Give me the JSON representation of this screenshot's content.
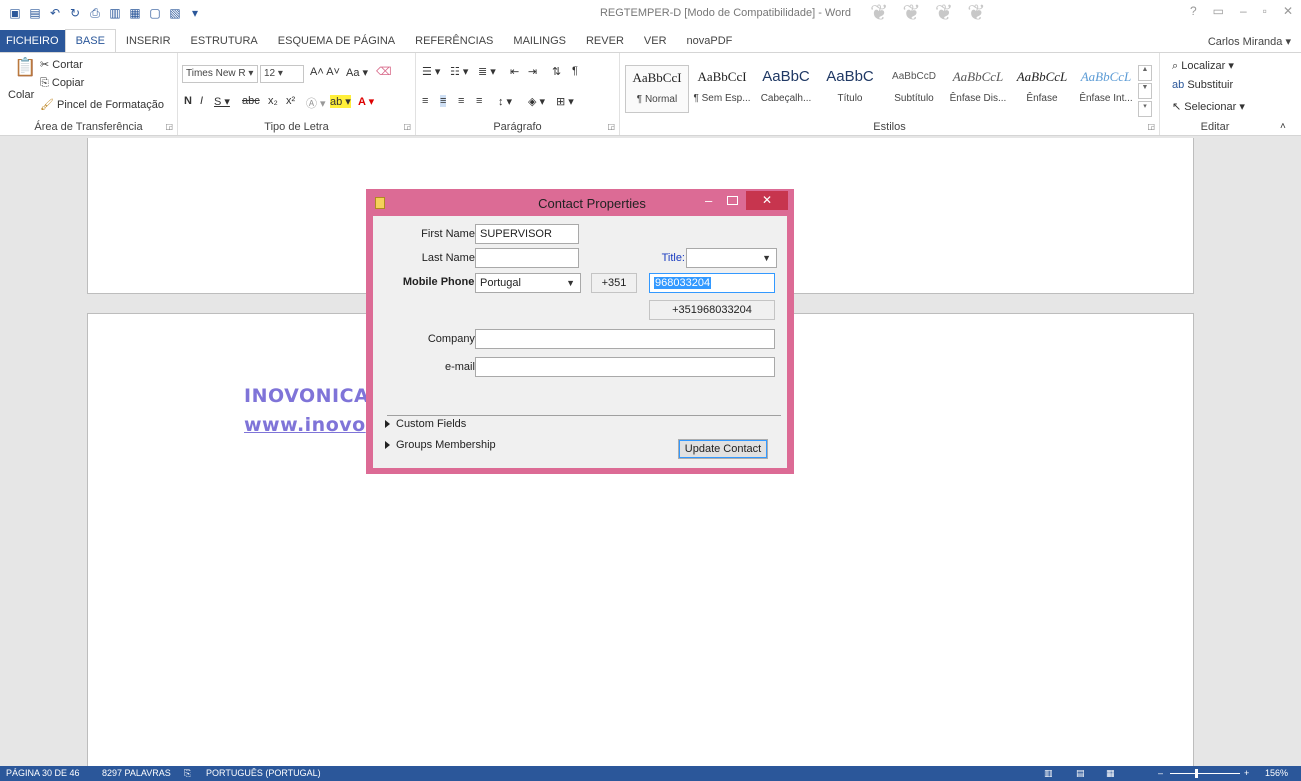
{
  "window": {
    "title": "REGTEMPER-D [Modo de Compatibilidade] - Word",
    "user": "Carlos Miranda"
  },
  "tabs": [
    "FICHEIRO",
    "BASE",
    "INSERIR",
    "ESTRUTURA",
    "ESQUEMA DE PÁGINA",
    "REFERÊNCIAS",
    "MAILINGS",
    "REVER",
    "VER",
    "novaPDF"
  ],
  "ribbon": {
    "clipboard": {
      "paste": "Colar",
      "cut": "Cortar",
      "copy": "Copiar",
      "format_painter": "Pincel de Formatação",
      "label": "Área de Transferência"
    },
    "font": {
      "name": "Times New R",
      "size": "12",
      "label": "Tipo de Letra"
    },
    "paragraph": {
      "label": "Parágrafo"
    },
    "styles": {
      "label": "Estilos",
      "items": [
        {
          "sample": "AaBbCcI",
          "name": "¶ Normal"
        },
        {
          "sample": "AaBbCcI",
          "name": "¶ Sem Esp..."
        },
        {
          "sample": "AaBbC",
          "name": "Cabeçalh..."
        },
        {
          "sample": "AaBbC",
          "name": "Título"
        },
        {
          "sample": "AaBbCcD",
          "name": "Subtítulo"
        },
        {
          "sample": "AaBbCcL",
          "name": "Ênfase Dis..."
        },
        {
          "sample": "AaBbCcL",
          "name": "Ênfase"
        },
        {
          "sample": "AaBbCcL",
          "name": "Ênfase Int..."
        }
      ]
    },
    "edit": {
      "find": "Localizar",
      "replace": "Substituir",
      "select": "Selecionar",
      "label": "Editar"
    }
  },
  "document": {
    "line1": "INOVONICA",
    "line2": "www.inovo"
  },
  "dialog": {
    "title": "Contact Properties",
    "first_name_label": "First Name:",
    "first_name": "SUPERVISOR",
    "last_name_label": "Last Name:",
    "last_name": "",
    "title_label": "Title:",
    "title_value": "",
    "mobile_label": "Mobile Phone:",
    "country": "Portugal",
    "country_code": "+351",
    "phone": "968033204",
    "full_phone": "+351968033204",
    "company_label": "Company:",
    "company": "",
    "email_label": "e-mail:",
    "email": "",
    "custom_fields": "Custom Fields",
    "groups": "Groups Membership",
    "update_button": "Update Contact"
  },
  "status": {
    "page": "PÁGINA 30 DE 46",
    "words": "8297 PALAVRAS",
    "language": "PORTUGUÊS (PORTUGAL)",
    "zoom": "156%"
  },
  "colors": {
    "accent": "#2b579a",
    "dialog_frame": "#dc6b95",
    "close": "#c7354e",
    "doc_text": "#7f74d8"
  }
}
